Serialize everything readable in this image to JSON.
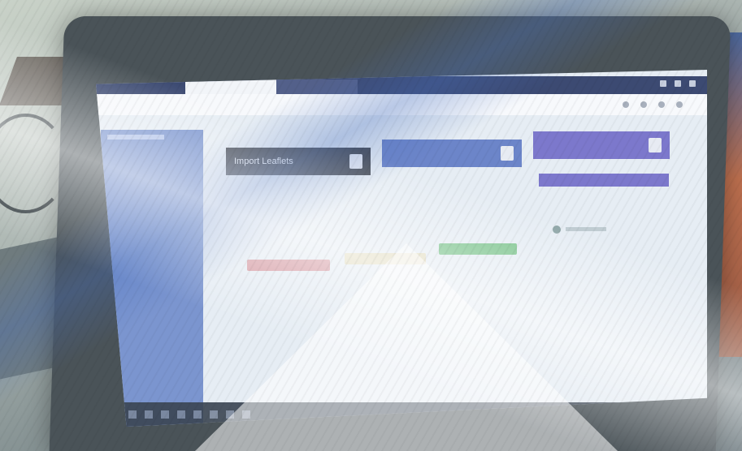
{
  "scene": {
    "description_tag": "photo-of-laptop-screen"
  },
  "app": {
    "window_tabs": [
      {
        "label": ""
      },
      {
        "label": ""
      }
    ]
  },
  "main": {
    "tiles": [
      {
        "label": "Import Leaflets",
        "icon": "document-icon"
      },
      {
        "label": "",
        "icon": "users-icon"
      },
      {
        "label": "",
        "icon": "cloud-icon"
      }
    ],
    "sub_button": {
      "label": ""
    },
    "status_chips": [
      {
        "label": "",
        "color": "#d7a0a8"
      },
      {
        "label": "",
        "color": "#e2dcc0"
      },
      {
        "label": "",
        "color": "#7dc48e"
      }
    ]
  },
  "colors": {
    "sidebar": "#7b95cf",
    "tile_dark": "#4b4f56",
    "tile_blue": "#6c85c9",
    "tile_purple": "#7c78cc"
  }
}
